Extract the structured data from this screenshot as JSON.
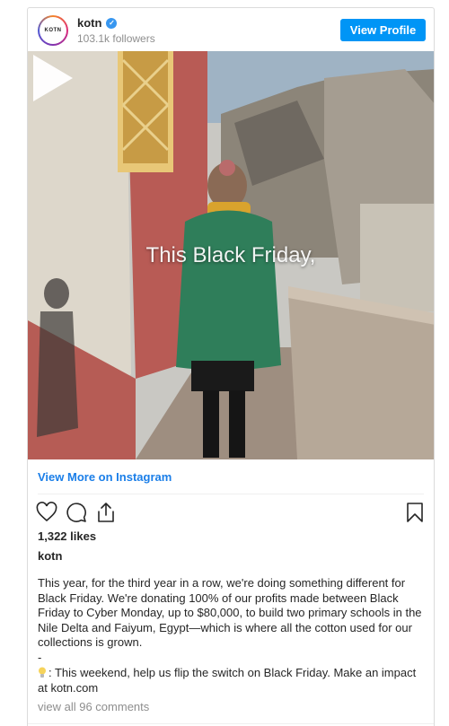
{
  "header": {
    "avatar_text": "KOTN",
    "username": "kotn",
    "followers": "103.1k followers",
    "view_profile_label": "View Profile"
  },
  "media": {
    "overlay_text": "This Black Friday,"
  },
  "footer": {
    "view_more": "View More on Instagram",
    "likes": "1,322 likes",
    "owner": "kotn",
    "caption_para1": "This year, for the third year in a row, we're doing something different for Black Friday. We're donating 100% of our profits made between Black Friday to Cyber Monday, up to $80,000, to build two primary schools in the Nile Delta and Faiyum, Egypt—which is where all the cotton used for our collections is grown.",
    "caption_dash": "-",
    "caption_para2": ": This weekend, help us flip the switch on Black Friday. Make an impact at kotn.com",
    "comments": "view all 96 comments"
  },
  "colors": {
    "accent": "#0095f6",
    "link": "#1a7ee8",
    "verified": "#3897f0"
  },
  "icons": [
    "heart-icon",
    "comment-icon",
    "share-icon",
    "bookmark-icon",
    "play-icon",
    "lightbulb-icon",
    "verified-icon"
  ]
}
